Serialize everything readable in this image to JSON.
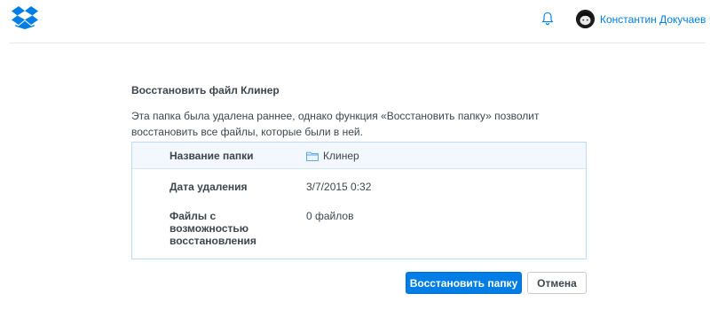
{
  "header": {
    "logo_icon": "dropbox-logo-icon",
    "notifications_icon": "bell-icon",
    "avatar_icon": "user-avatar-icon",
    "user_name": "Константин Докучаев",
    "dropdown_icon": "chevron-down-icon"
  },
  "dialog": {
    "title": "Восстановить файл Клинер",
    "description": "Эта папка была удалена раннее, однако функция «Восстановить папку» позволит восстановить все файлы, которые были в ней.",
    "rows": [
      {
        "label": "Название папки",
        "value": "Клинер",
        "icon": "folder-icon"
      },
      {
        "label": "Дата удаления",
        "value": "3/7/2015 0:32"
      },
      {
        "label": "Файлы с возможностью восстановления",
        "value": "0 файлов"
      }
    ],
    "restore_button": "Восстановить папку",
    "cancel_button": "Отмена"
  },
  "colors": {
    "accent": "#007ee5",
    "table_border": "#bfdcf5",
    "table_header_bg": "#f2f8fd",
    "text": "#3d464d"
  }
}
